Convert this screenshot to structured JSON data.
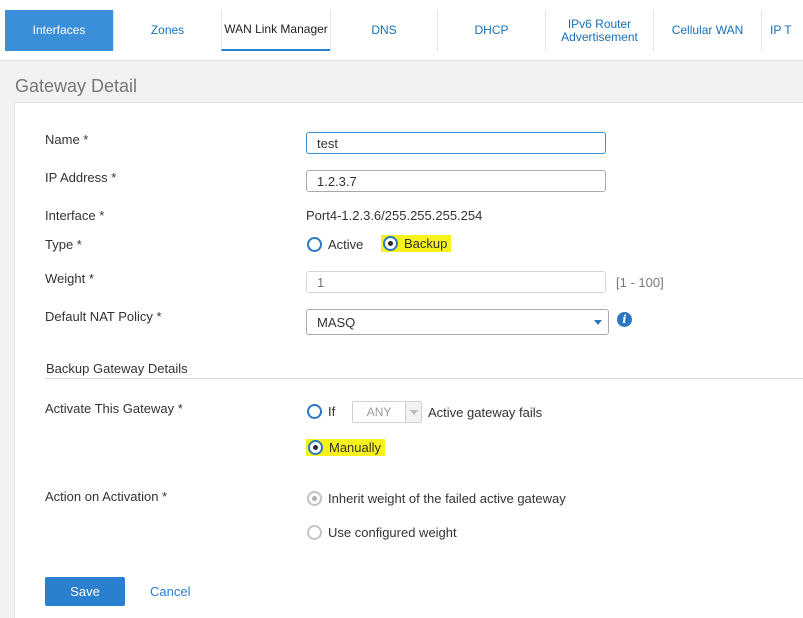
{
  "tabs": [
    {
      "label": "Interfaces"
    },
    {
      "label": "Zones"
    },
    {
      "label": "WAN Link Manager"
    },
    {
      "label": "DNS"
    },
    {
      "label": "DHCP"
    },
    {
      "label": "IPv6 Router Advertisement"
    },
    {
      "label": "Cellular WAN"
    },
    {
      "label": "IP T"
    }
  ],
  "page_title": "Gateway Detail",
  "form": {
    "name": {
      "label": "Name *",
      "value": "test"
    },
    "ip_address": {
      "label": "IP Address *",
      "value": "1.2.3.7"
    },
    "interface": {
      "label": "Interface *",
      "value": "Port4-1.2.3.6/255.255.255.254"
    },
    "type": {
      "label": "Type *",
      "options": [
        "Active",
        "Backup"
      ],
      "selected": "Backup"
    },
    "weight": {
      "label": "Weight *",
      "placeholder": "1",
      "range": "[1 - 100]"
    },
    "nat_policy": {
      "label": "Default NAT Policy *",
      "value": "MASQ"
    },
    "backup_section_title": "Backup Gateway Details",
    "activate": {
      "label": "Activate This Gateway *",
      "if_label": "If",
      "any_value": "ANY",
      "fails_label": "Active gateway fails",
      "manually_label": "Manually",
      "selected": "Manually"
    },
    "action": {
      "label": "Action on Activation *",
      "inherit_label": "Inherit weight of the failed active gateway",
      "configured_label": "Use configured weight",
      "selected": "inherit"
    }
  },
  "buttons": {
    "save": "Save",
    "cancel": "Cancel"
  },
  "colors": {
    "accent": "#2a7fcf",
    "active_tab": "#3b8fd9",
    "highlight": "#f7f21a"
  }
}
